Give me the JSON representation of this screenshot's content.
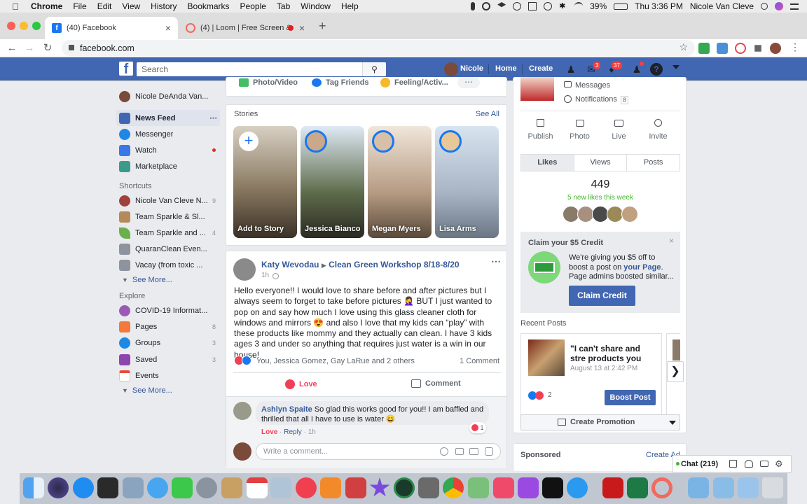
{
  "menubar": {
    "app": "Chrome",
    "items": [
      "File",
      "Edit",
      "View",
      "History",
      "Bookmarks",
      "People",
      "Tab",
      "Window",
      "Help"
    ],
    "battery": "39%",
    "clock": "Thu 3:36 PM",
    "user": "Nicole Van Cleve"
  },
  "tabs": [
    {
      "title": "(40) Facebook",
      "favicon": "facebook-icon",
      "color": "#1877f2"
    },
    {
      "title": "(4) | Loom | Free Screen &",
      "favicon": "loom-icon",
      "color": "#f06a5f"
    }
  ],
  "address": {
    "url": "facebook.com"
  },
  "fb_header": {
    "search_placeholder": "Search",
    "profile_name": "Nicole",
    "home": "Home",
    "create": "Create",
    "messages_badge": "3",
    "notifications_badge": "37"
  },
  "left_nav": {
    "profile": "Nicole DeAnda Van...",
    "main": [
      {
        "label": "News Feed",
        "icon": "news-feed-icon",
        "color": "#4267b2"
      },
      {
        "label": "Messenger",
        "icon": "messenger-icon",
        "color": "#1e88e5"
      },
      {
        "label": "Watch",
        "icon": "watch-icon",
        "color": "#3b78e7"
      },
      {
        "label": "Marketplace",
        "icon": "marketplace-icon",
        "color": "#3a9b8a"
      }
    ],
    "shortcuts_title": "Shortcuts",
    "shortcuts": [
      {
        "label": "Nicole Van Cleve N...",
        "count": "9"
      },
      {
        "label": "Team Sparkle & Sl...",
        "count": ""
      },
      {
        "label": "Team Sparkle and ...",
        "count": "4"
      },
      {
        "label": "QuaranClean Even...",
        "count": ""
      },
      {
        "label": "Vacay (from toxic ...",
        "count": ""
      }
    ],
    "see_more_1": "See More...",
    "explore_title": "Explore",
    "explore": [
      {
        "label": "COVID-19 Informat...",
        "count": "",
        "icon": "covid-info-icon",
        "color": "#9b59b6"
      },
      {
        "label": "Pages",
        "count": "8",
        "icon": "pages-flag-icon",
        "color": "#f5793a"
      },
      {
        "label": "Groups",
        "count": "3",
        "icon": "groups-icon",
        "color": "#1e88e5"
      },
      {
        "label": "Saved",
        "count": "3",
        "icon": "saved-icon",
        "color": "#8e44ad"
      },
      {
        "label": "Events",
        "count": "",
        "icon": "events-calendar-icon",
        "color": "#e74c3c"
      }
    ],
    "see_more_2": "See More..."
  },
  "composer": {
    "photo": "Photo/Video",
    "tag": "Tag Friends",
    "feeling": "Feeling/Activ..."
  },
  "stories": {
    "title": "Stories",
    "see_all": "See All",
    "items": [
      {
        "name": "Add to Story",
        "color": "#8a7a62"
      },
      {
        "name": "Jessica Bianco",
        "color": "#5d6b4a"
      },
      {
        "name": "Megan Myers",
        "color": "#b59a82"
      },
      {
        "name": "Lisa Arms",
        "color": "#a8b4c4"
      }
    ]
  },
  "post": {
    "author": "Katy Wevodau",
    "group": "Clean Green Workshop 8/18-8/20",
    "time": "1h",
    "text": "Hello everyone!! I would love to share before and after pictures but I always seem to forget to take before pictures 🤦‍♀️ BUT I just wanted to pop on and say how much I love using this glass cleaner cloth for windows and mirrors 😍 and also I love that my kids can “play” with these products like mommy and they actually can clean. I have 3 kids ages 3 and under so anything that requires just water is a win in our house!",
    "reactions": "You, Jessica Gomez, Gay LaRue and 2 others",
    "comments_count": "1 Comment",
    "love": "Love",
    "comment": "Comment",
    "reply": {
      "author": "Ashlyn Spaite",
      "text": "So glad this works good for you!! I am baffled and thrilled that all I have to use is water 😄",
      "love": "Love",
      "reply": "Reply",
      "time": "1h",
      "reaction_count": "1"
    },
    "write_placeholder": "Write a comment..."
  },
  "page_panel": {
    "messages": "Messages",
    "notifications": "Notifications",
    "notifications_count": "8",
    "actions": [
      "Publish",
      "Photo",
      "Live",
      "Invite"
    ],
    "tabs": [
      "Likes",
      "Views",
      "Posts"
    ],
    "likes": "449",
    "new_likes": "5 new likes this week"
  },
  "credit": {
    "title": "Claim your $5 Credit",
    "text_a": "We're giving you $5 off to boost a post on ",
    "text_link": "your Page",
    "text_b": ". Page admins boosted similar...",
    "button": "Claim Credit"
  },
  "recent_posts": {
    "title": "Recent Posts",
    "post_title": "\"I can't share and stre products you find on t",
    "date": "August 13 at 2:42 PM",
    "reactions": "2",
    "boost": "Boost Post"
  },
  "create_promotion": "Create Promotion",
  "sponsored": {
    "title": "Sponsored",
    "create_ad": "Create Ad"
  },
  "chat": {
    "label": "Chat (219)"
  }
}
